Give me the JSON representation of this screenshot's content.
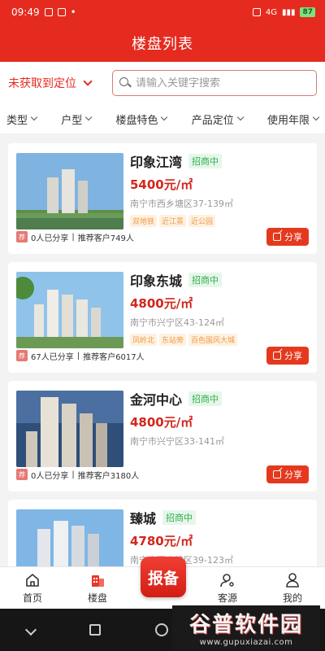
{
  "status_bar": {
    "time": "09:49",
    "battery": "87",
    "network": "4G"
  },
  "header": {
    "title": "楼盘列表"
  },
  "location": {
    "label": "未获取到定位"
  },
  "search": {
    "placeholder": "请输入关键字搜索",
    "value": ""
  },
  "filters": [
    "类型",
    "户型",
    "楼盘特色",
    "产品定位",
    "使用年限"
  ],
  "listings": [
    {
      "name": "印象江湾",
      "status": "招商中",
      "price": "5400元/㎡",
      "address": "南宁市西乡塘区37-139㎡",
      "features": [
        "双地铁",
        "近江景",
        "近公园"
      ],
      "shared": "0人已分享",
      "referred": "推荐客户749人",
      "share_label": "分享"
    },
    {
      "name": "印象东城",
      "status": "招商中",
      "price": "4800元/㎡",
      "address": "南宁市兴宁区43-124㎡",
      "features": [
        "凤岭北",
        "东站旁",
        "百色国风大城"
      ],
      "shared": "67人已分享",
      "referred": "推荐客户6017人",
      "share_label": "分享"
    },
    {
      "name": "金河中心",
      "status": "招商中",
      "price": "4800元/㎡",
      "address": "南宁市兴宁区33-141㎡",
      "features": [],
      "shared": "0人已分享",
      "referred": "推荐客户3180人",
      "share_label": "分享"
    },
    {
      "name": "臻城",
      "status": "招商中",
      "price": "4780元/㎡",
      "address": "南宁市西乡塘区39-123㎡",
      "features": [],
      "shared": "",
      "referred": "",
      "share_label": ""
    }
  ],
  "tabbar": {
    "home": "首页",
    "listings": "楼盘",
    "report": "报备",
    "customers": "客源",
    "mine": "我的"
  },
  "watermark": {
    "title": "谷普软件园",
    "url": "www.gupuxiazai.com"
  },
  "colors": {
    "brand": "#e52b1f",
    "status_green": "#2fae4f",
    "feature_orange": "#ec9a4a"
  }
}
